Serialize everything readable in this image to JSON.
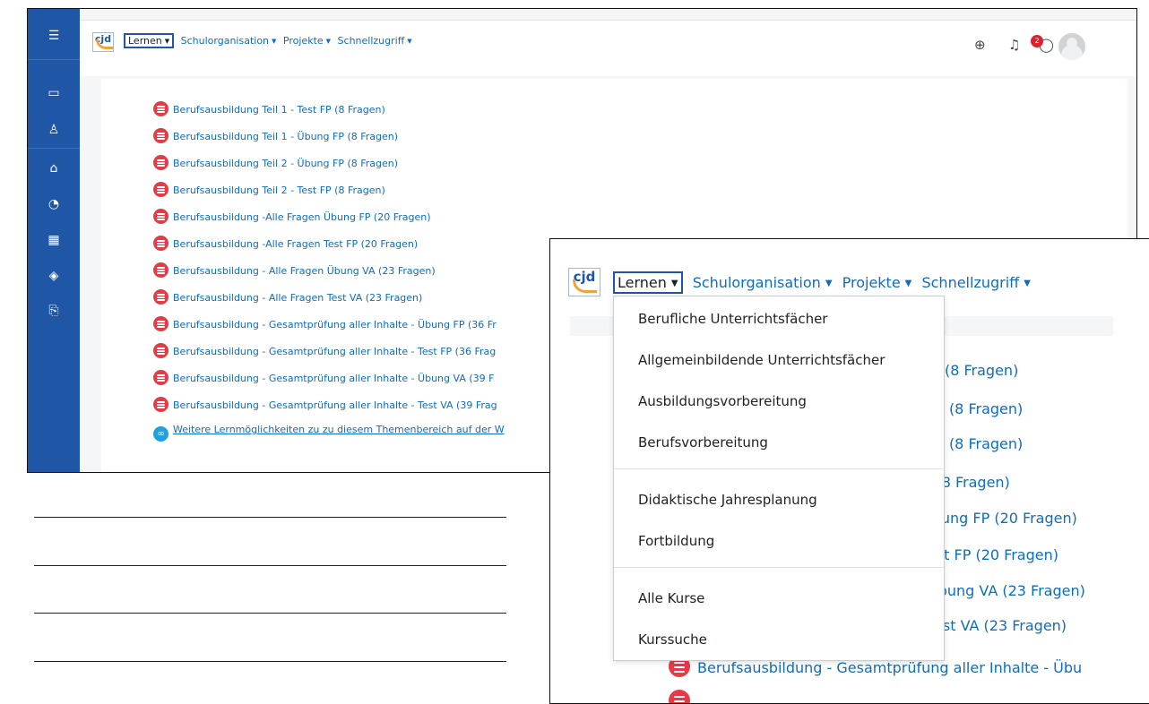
{
  "brand": {
    "logo_text": "cjd"
  },
  "nav": {
    "items": [
      "Lernen",
      "Schulorganisation",
      "Projekte",
      "Schnellzugriff"
    ]
  },
  "notifications": {
    "count": "2"
  },
  "questions": [
    "Berufsausbildung Teil 1 - Test FP (8 Fragen)",
    "Berufsausbildung Teil 1 - Übung FP (8 Fragen)",
    "Berufsausbildung Teil 2 - Übung FP (8 Fragen)",
    "Berufsausbildung Teil 2 - Test FP (8 Fragen)",
    "Berufsausbildung -Alle Fragen Übung FP (20 Fragen)",
    "Berufsausbildung -Alle Fragen Test FP (20 Fragen)",
    "Berufsausbildung - Alle Fragen Übung VA (23 Fragen)",
    "Berufsausbildung - Alle Fragen Test VA (23 Fragen)",
    "Berufsausbildung - Gesamtprüfung aller Inhalte - Übung FP (36 Fr",
    "Berufsausbildung - Gesamtprüfung aller Inhalte - Test FP (36 Frag",
    "Berufsausbildung - Gesamtprüfung aller Inhalte - Übung VA (39 F",
    "Berufsausbildung - Gesamtprüfung aller Inhalte - Test VA (39 Frag"
  ],
  "more_link": "Weitere Lernmöglichkeiten zu zu diesem Themenbereich auf der W",
  "dropdown": {
    "items": [
      "Berufliche Unterrichtsfächer",
      "Allgemeinbildende Unterrichtsfächer",
      "Ausbildungsvorbereitung",
      "Berufsvorbereitung",
      "Didaktische Jahresplanung",
      "Fortbildung",
      "Alle Kurse",
      "Kurssuche"
    ]
  },
  "zoom_fragments": [
    "(8 Fragen)",
    "FP (8 Fragen)",
    "FP (8 Fragen)",
    "' (8 Fragen)",
    "Jbung FP (20 Fragen)",
    "est FP (20 Fragen)",
    "Übung VA (23 Fragen)",
    "Test VA (23 Fragen)",
    "Berufsausbildung - Gesamtprüfung aller Inhalte - Übu"
  ],
  "blank_lines": 4
}
